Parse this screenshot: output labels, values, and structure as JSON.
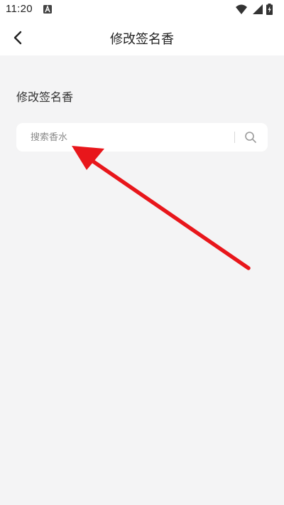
{
  "status_bar": {
    "time": "11:20"
  },
  "header": {
    "title": "修改签名香",
    "back_icon": "chevron-left-icon"
  },
  "main": {
    "section_heading": "修改签名香",
    "search": {
      "placeholder": "搜索香水",
      "value": "",
      "icon": "search-icon"
    }
  },
  "colors": {
    "background": "#f4f4f5",
    "annotation_arrow": "#e8161b"
  }
}
